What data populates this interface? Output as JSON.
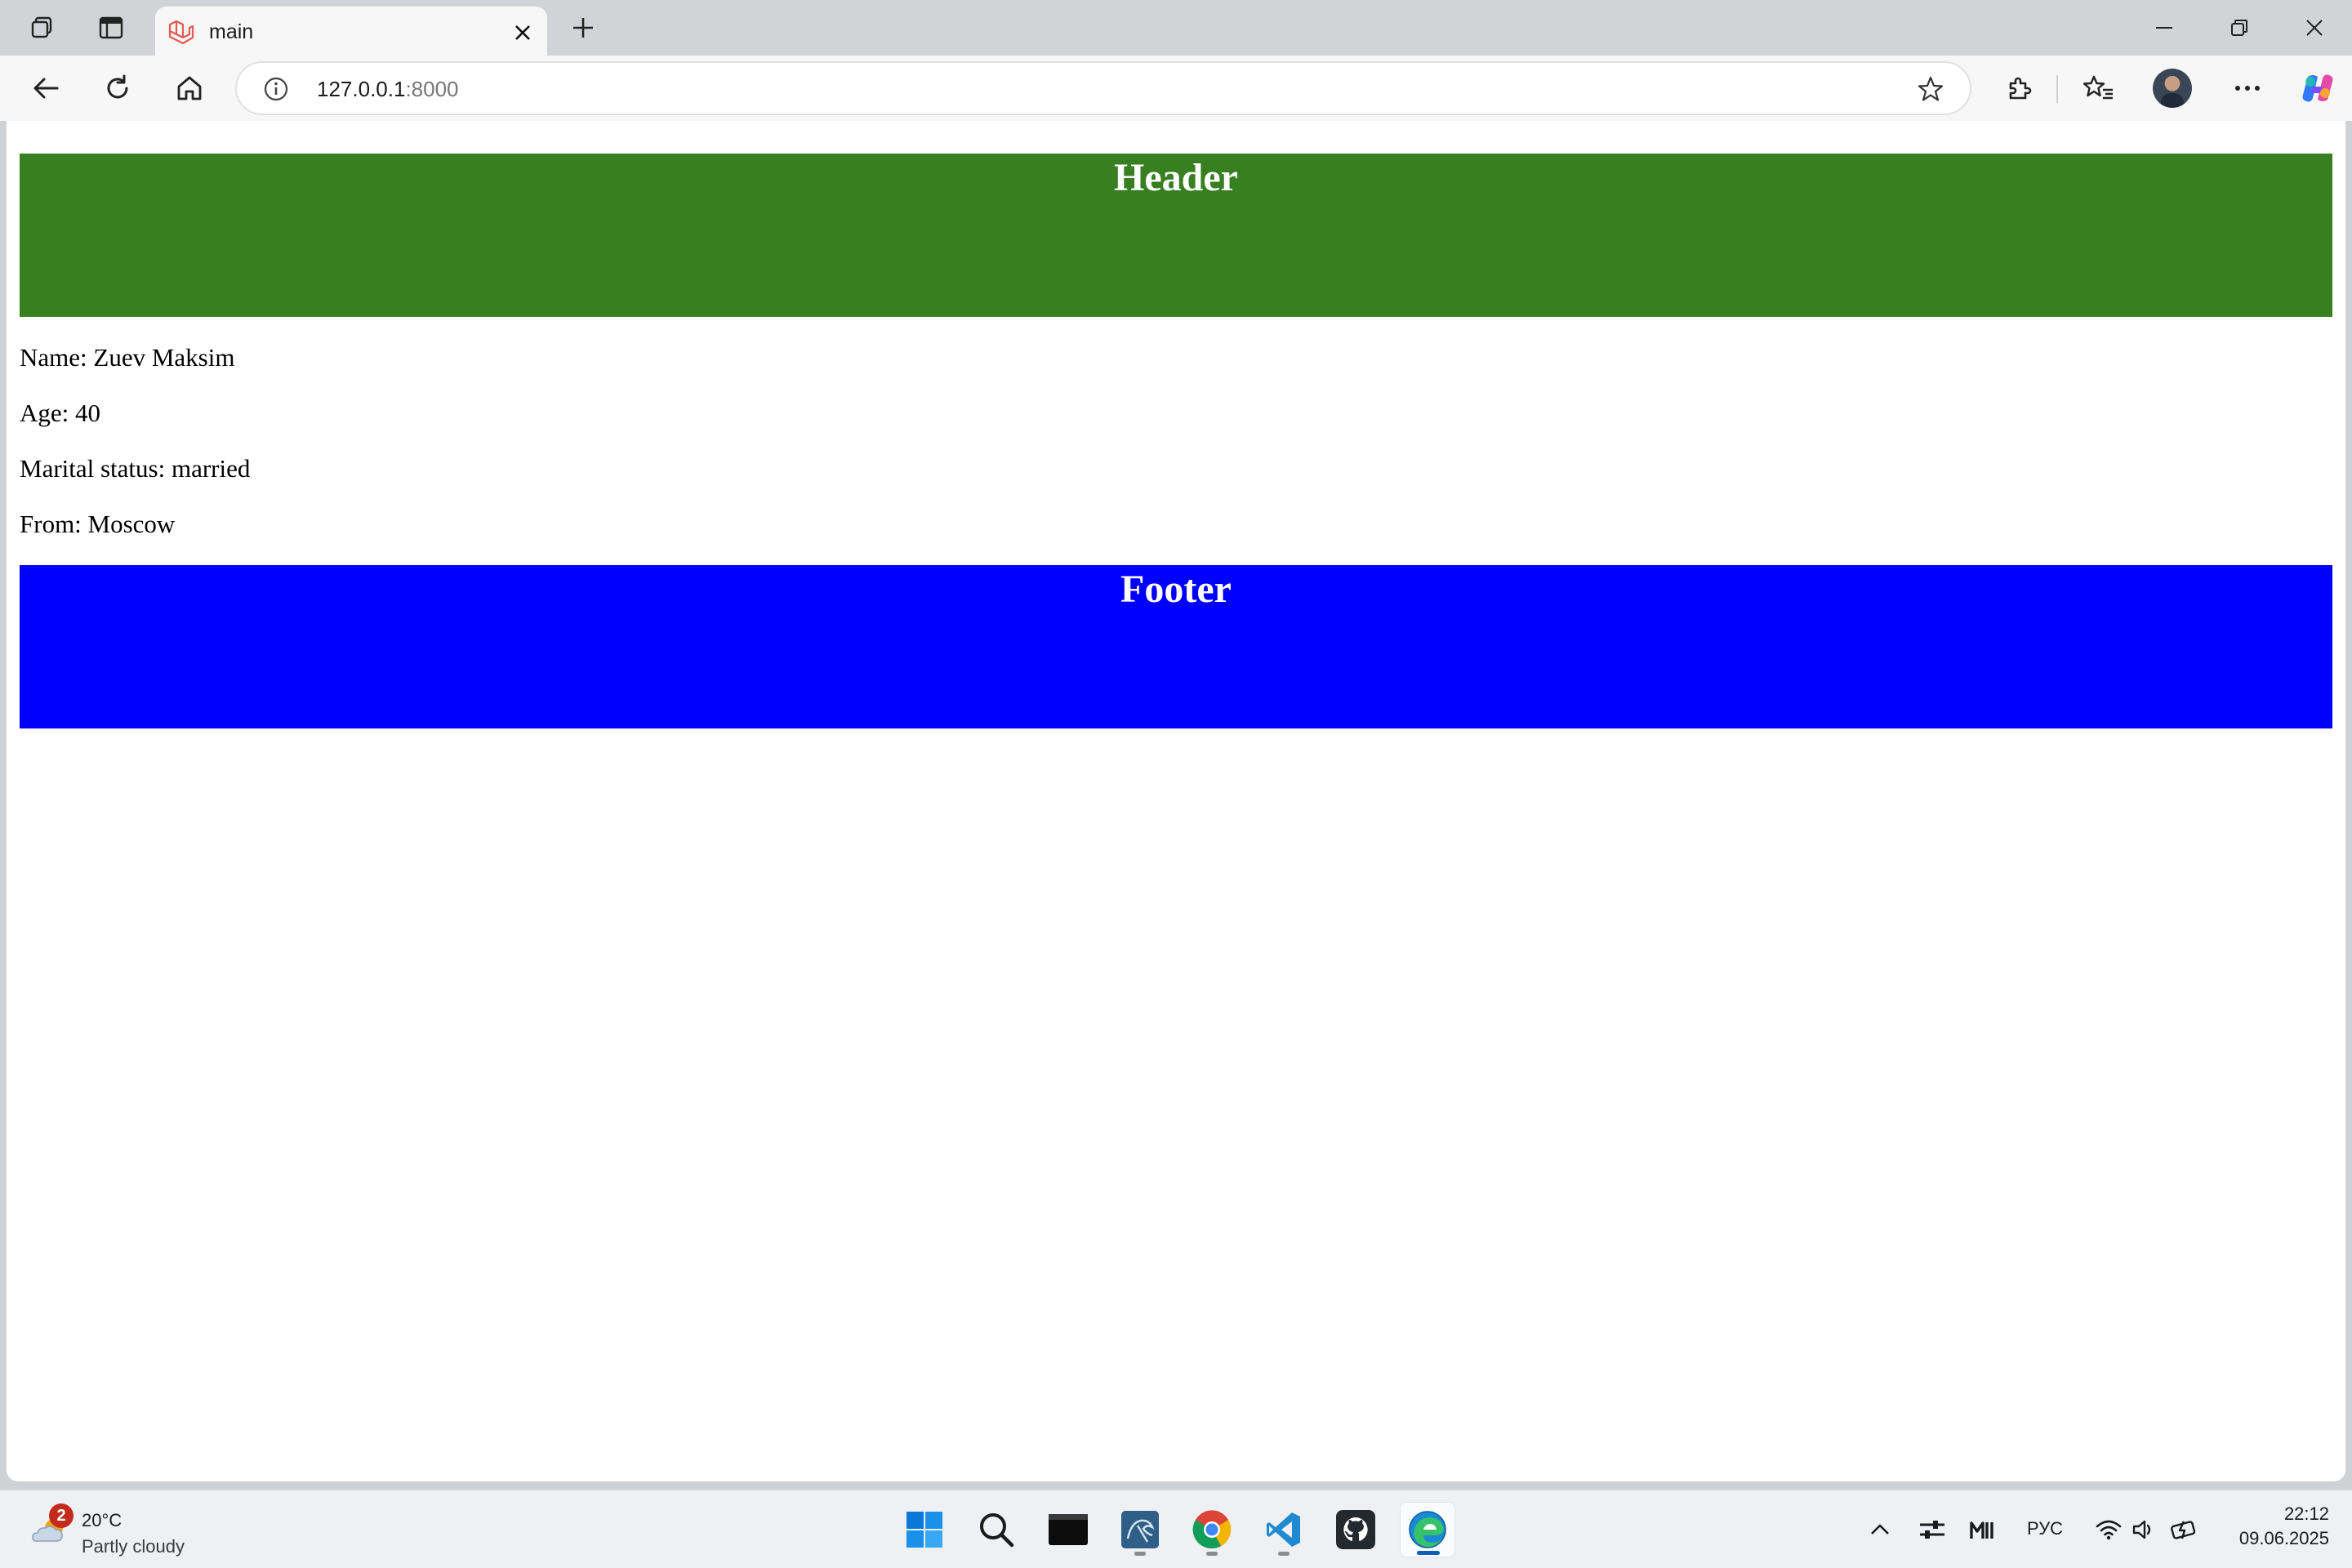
{
  "browser": {
    "tab_title": "main",
    "url_host": "127.0.0.1",
    "url_port": ":8000"
  },
  "page": {
    "header_title": "Header",
    "info_lines": [
      "Name: Zuev Maksim",
      "Age: 40",
      "Marital status: married",
      "From: Moscow"
    ],
    "footer_title": "Footer",
    "colors": {
      "header_bg": "#387f22",
      "footer_bg": "#0000ff",
      "heading_text": "#ffffff"
    }
  },
  "taskbar": {
    "weather_badge": "2",
    "weather_temp": "20°C",
    "weather_desc": "Partly cloudy",
    "language": "РУС",
    "time": "22:12",
    "date": "09.06.2025",
    "apps": [
      "start-icon",
      "search-icon",
      "terminal-icon",
      "mysql-workbench-icon",
      "chrome-icon",
      "vscode-icon",
      "github-desktop-icon",
      "edge-icon"
    ]
  }
}
